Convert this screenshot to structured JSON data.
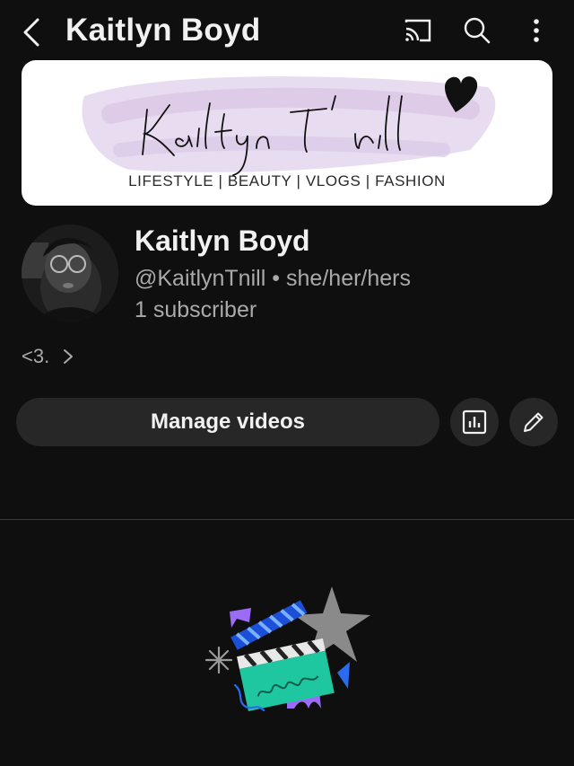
{
  "header": {
    "title": "Kaitlyn Boyd",
    "icons": [
      "back-arrow-icon",
      "cast-icon",
      "search-icon",
      "more-vert-icon"
    ]
  },
  "banner": {
    "script_title": "Kaitlyn T'nill",
    "tagline": "LIFESTYLE | BEAUTY | VLOGS | FASHION"
  },
  "channel": {
    "name": "Kaitlyn Boyd",
    "handle": "@KaitlynTnill",
    "separator": "•",
    "pronouns": "she/her/hers",
    "subscribers": "1 subscriber",
    "description": "<3."
  },
  "actions": {
    "manage_videos": "Manage videos",
    "analytics_icon": "analytics-icon",
    "edit_icon": "pencil-icon"
  },
  "colors": {
    "background": "#0f0f0f",
    "surface": "#272727",
    "secondary_text": "#aaaaaa",
    "banner_brush": "#e4d6ee"
  }
}
